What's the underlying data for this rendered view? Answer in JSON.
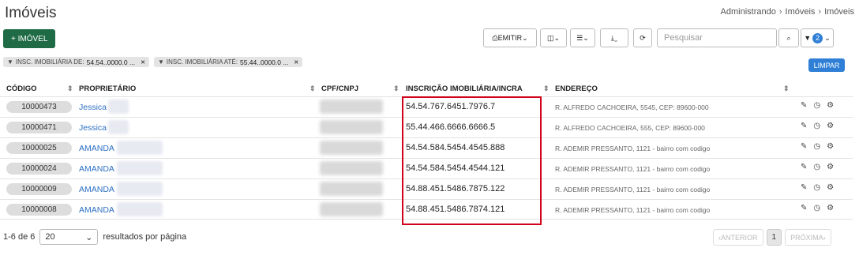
{
  "page": {
    "title": "Imóveis"
  },
  "breadcrumb": [
    "Administrando",
    "Imóveis",
    "Imóveis"
  ],
  "toolbar": {
    "new_label": "+ IMÓVEL",
    "emitir_label": "EMITIR",
    "search_placeholder": "Pesquisar",
    "filter_count": "2"
  },
  "filters": [
    {
      "label": "INSC. IMOBILIÁRIA DE:",
      "value": "54.54..0000.0 ..."
    },
    {
      "label": "INSC. IMOBILIÁRIA ATÉ:",
      "value": "55.44..0000.0 ..."
    }
  ],
  "clear_label": "LIMPAR",
  "table": {
    "headers": [
      "CÓDIGO",
      "PROPRIETÁRIO",
      "CPF/CNPJ",
      "INSCRIÇÃO IMOBILIÁRIA/INCRA",
      "ENDEREÇO"
    ],
    "rows": [
      {
        "code": "10000473",
        "owner": "Jessica",
        "insc": "54.54.767.6451.7976.7",
        "address": "R. ALFREDO CACHOEIRA, 5545, CEP: 89600-000"
      },
      {
        "code": "10000471",
        "owner": "Jessica",
        "insc": "55.44.466.6666.6666.5",
        "address": "R. ALFREDO CACHOEIRA, 555, CEP: 89600-000"
      },
      {
        "code": "10000025",
        "owner": "AMANDA",
        "insc": "54.54.584.5454.4545.888",
        "address": "R. ADEMIR PRESSANTO, 1121 - bairro com codigo"
      },
      {
        "code": "10000024",
        "owner": "AMANDA",
        "insc": "54.54.584.5454.4544.121",
        "address": "R. ADEMIR PRESSANTO, 1121 - bairro com codigo"
      },
      {
        "code": "10000009",
        "owner": "AMANDA",
        "insc": "54.88.451.5486.7875.122",
        "address": "R. ADEMIR PRESSANTO, 1121 - bairro com codigo"
      },
      {
        "code": "10000008",
        "owner": "AMANDA",
        "insc": "54.88.451.5486.7874.121",
        "address": "R. ADEMIR PRESSANTO, 1121 - bairro com codigo"
      }
    ]
  },
  "footer": {
    "range": "1-6 de 6",
    "page_size": "20",
    "per_page_label": "resultados por página"
  },
  "pagination": {
    "prev": "‹ANTERIOR",
    "current": "1",
    "next": "PRÓXIMA›"
  },
  "colors": {
    "primary_green": "#1e6b45",
    "link_blue": "#2b6fc2",
    "highlight_red": "#d0021b",
    "clear_blue": "#2f7fd6"
  }
}
